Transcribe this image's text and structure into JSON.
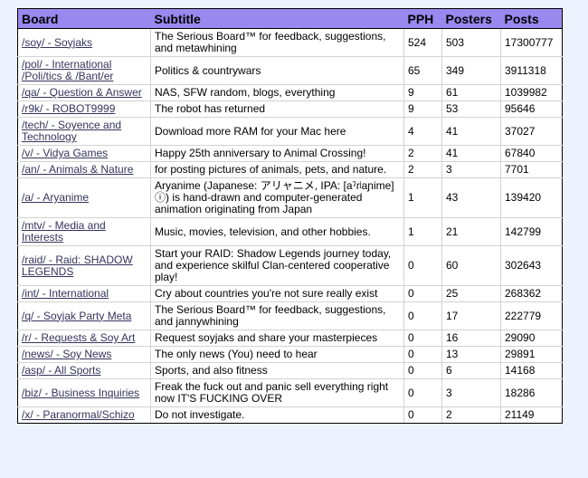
{
  "table": {
    "headers": {
      "board": "Board",
      "subtitle": "Subtitle",
      "pph": "PPH",
      "posters": "Posters",
      "posts": "Posts"
    },
    "rows": [
      {
        "board": "/soy/ - Soyjaks",
        "subtitle": "The Serious Board™ for feedback, suggestions, and metawhining",
        "pph": "524",
        "posters": "503",
        "posts": "17300777"
      },
      {
        "board": "/pol/ - International /Poli/tics & /Bant/er",
        "subtitle": "Politics & countrywars",
        "pph": "65",
        "posters": "349",
        "posts": "3911318"
      },
      {
        "board": "/qa/ - Question & Answer",
        "subtitle": "NAS, SFW random, blogs, everything",
        "pph": "9",
        "posters": "61",
        "posts": "1039982"
      },
      {
        "board": "/r9k/ - ROBOT9999",
        "subtitle": "The robot has returned",
        "pph": "9",
        "posters": "53",
        "posts": "95646"
      },
      {
        "board": "/tech/ - Soyence and Technology",
        "subtitle": "Download more RAM for your Mac here",
        "pph": "4",
        "posters": "41",
        "posts": "37027"
      },
      {
        "board": "/v/ - Vidya Games",
        "subtitle": "Happy 25th anniversary to Animal Crossing!",
        "pph": "2",
        "posters": "41",
        "posts": "67840"
      },
      {
        "board": "/an/ - Animals & Nature",
        "subtitle": "for posting pictures of animals, pets, and nature.",
        "pph": "2",
        "posters": "3",
        "posts": "7701"
      },
      {
        "board": "/a/ - Aryanime",
        "subtitle": "Aryanime (Japanese: アリャニメ, IPA: [aˀɾʲaɲime] ⓘ) is hand-drawn and computer-generated animation originating from Japan",
        "pph": "1",
        "posters": "43",
        "posts": "139420"
      },
      {
        "board": "/mtv/ - Media and Interests",
        "subtitle": "Music, movies, television, and other hobbies.",
        "pph": "1",
        "posters": "21",
        "posts": "142799"
      },
      {
        "board": "/raid/ - Raid: SHADOW LEGENDS",
        "subtitle": "Start your RAID: Shadow Legends journey today, and experience skilful Clan-centered cooperative play!",
        "pph": "0",
        "posters": "60",
        "posts": "302643"
      },
      {
        "board": "/int/ - International",
        "subtitle": "Cry about countries you're not sure really exist",
        "pph": "0",
        "posters": "25",
        "posts": "268362"
      },
      {
        "board": "/q/ - Soyjak Party Meta",
        "subtitle": "The Serious Board™ for feedback, suggestions, and jannywhining",
        "pph": "0",
        "posters": "17",
        "posts": "222779"
      },
      {
        "board": "/r/ - Requests & Soy Art",
        "subtitle": "Request soyjaks and share your masterpieces",
        "pph": "0",
        "posters": "16",
        "posts": "29090"
      },
      {
        "board": "/news/ - Soy News",
        "subtitle": "The only news (You) need to hear",
        "pph": "0",
        "posters": "13",
        "posts": "29891"
      },
      {
        "board": "/asp/ - All Sports",
        "subtitle": "Sports, and also fitness",
        "pph": "0",
        "posters": "6",
        "posts": "14168"
      },
      {
        "board": "/biz/ - Business Inquiries",
        "subtitle": "Freak the fuck out and panic sell everything right now IT'S FUCKING OVER",
        "pph": "0",
        "posters": "3",
        "posts": "18286"
      },
      {
        "board": "/x/ - Paranormal/Schizo",
        "subtitle": "Do not investigate.",
        "pph": "0",
        "posters": "2",
        "posts": "21149"
      }
    ]
  },
  "colors": {
    "page_background": "#eef2ff",
    "header_background": "#9988ee",
    "link": "#34345c"
  }
}
